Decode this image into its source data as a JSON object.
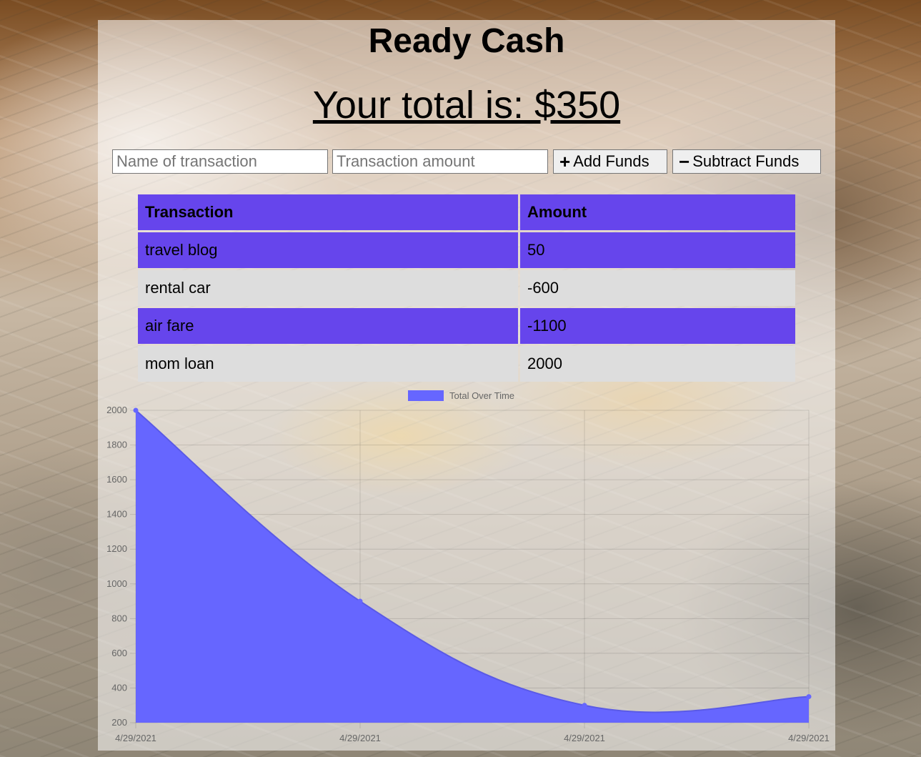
{
  "app": {
    "title": "Ready Cash",
    "total_text": "Your total is: $350"
  },
  "form": {
    "name_placeholder": "Name of transaction",
    "amount_placeholder": "Transaction amount",
    "add_label": "Add Funds",
    "subtract_label": "Subtract Funds",
    "add_icon": "plus-icon",
    "subtract_icon": "minus-icon"
  },
  "table": {
    "headers": [
      "Transaction",
      "Amount"
    ],
    "rows": [
      {
        "name": "travel blog",
        "amount": "50"
      },
      {
        "name": "rental car",
        "amount": "-600"
      },
      {
        "name": "air fare",
        "amount": "-1100"
      },
      {
        "name": "mom loan",
        "amount": "2000"
      }
    ],
    "colors": {
      "purple": "#6645ec",
      "grey": "#dddddd"
    }
  },
  "chart_data": {
    "type": "area",
    "legend": "Total Over Time",
    "legend_position": "top",
    "x": [
      "4/29/2021",
      "4/29/2021",
      "4/29/2021",
      "4/29/2021"
    ],
    "series": [
      {
        "name": "Total Over Time",
        "values": [
          2000,
          900,
          300,
          350
        ],
        "color": "#6666ff"
      }
    ],
    "ylim": [
      200,
      2000
    ],
    "yticks": [
      200,
      400,
      600,
      800,
      1000,
      1200,
      1400,
      1600,
      1800,
      2000
    ],
    "grid": true
  }
}
